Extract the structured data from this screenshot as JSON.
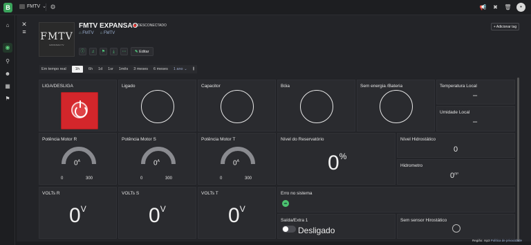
{
  "topbar": {
    "logo": "B",
    "org_name": "FMTV"
  },
  "device": {
    "thumb_text": "FMTV",
    "thumb_subtext": "EXPANSAO TV",
    "title": "FMTV EXPANSAO",
    "status": "DESCONECTADO",
    "breadcrumbs": [
      "FMTV",
      "FMTV"
    ],
    "add_tag_label": "+ Adicionar tag",
    "edit_label": "Editar"
  },
  "timebar": {
    "items": [
      "Em tempo real",
      "1h",
      "6h",
      "1d",
      "1sr",
      "1mês",
      "3 meses",
      "6 meses",
      "1 ano"
    ],
    "selected_index": 1
  },
  "cards": {
    "liga": {
      "label": "LIGA/DESLIGA"
    },
    "ligado": {
      "label": "Ligado"
    },
    "capacitor": {
      "label": "Capacitor"
    },
    "boia": {
      "label": "Bóia"
    },
    "sem_energia": {
      "label": "Sem energia /Bateria"
    },
    "temp": {
      "label": "Temperatura Local",
      "value": "–"
    },
    "umidade": {
      "label": "Umidade Local",
      "value": "–"
    },
    "motor_r": {
      "label": "Potência Motor R",
      "value": "0",
      "unit": "A",
      "min": "0",
      "max": "300",
      "fill": 0
    },
    "motor_s": {
      "label": "Potência Motor S",
      "value": "0",
      "unit": "A",
      "min": "0",
      "max": "300",
      "fill": 0
    },
    "motor_t": {
      "label": "Potência Motor T",
      "value": "0",
      "unit": "A",
      "min": "0",
      "max": "300",
      "fill": 0
    },
    "reservatorio": {
      "label": "Nível do Reservatório",
      "value": "0",
      "unit": "%"
    },
    "hidrostatico": {
      "label": "Nível Hidrostático",
      "value": "0"
    },
    "hidrometro": {
      "label": "Hidrometro",
      "value": "0",
      "unit": "m³"
    },
    "volts_r": {
      "label": "VOLTs R",
      "value": "0",
      "unit": "V"
    },
    "volts_s": {
      "label": "VOLTs S",
      "value": "0",
      "unit": "V"
    },
    "volts_t": {
      "label": "VOLTs T",
      "value": "0",
      "unit": "V"
    },
    "erro": {
      "label": "Erro no sistema",
      "badge": "ok"
    },
    "saida": {
      "label": "Saída/Extra 1",
      "toggle_label": "Desligado"
    },
    "sem_sensor": {
      "label": "Sem sensor Hirostático"
    }
  },
  "footer": {
    "region": "Região: rsp3",
    "privacy": "Política de privacidade"
  }
}
